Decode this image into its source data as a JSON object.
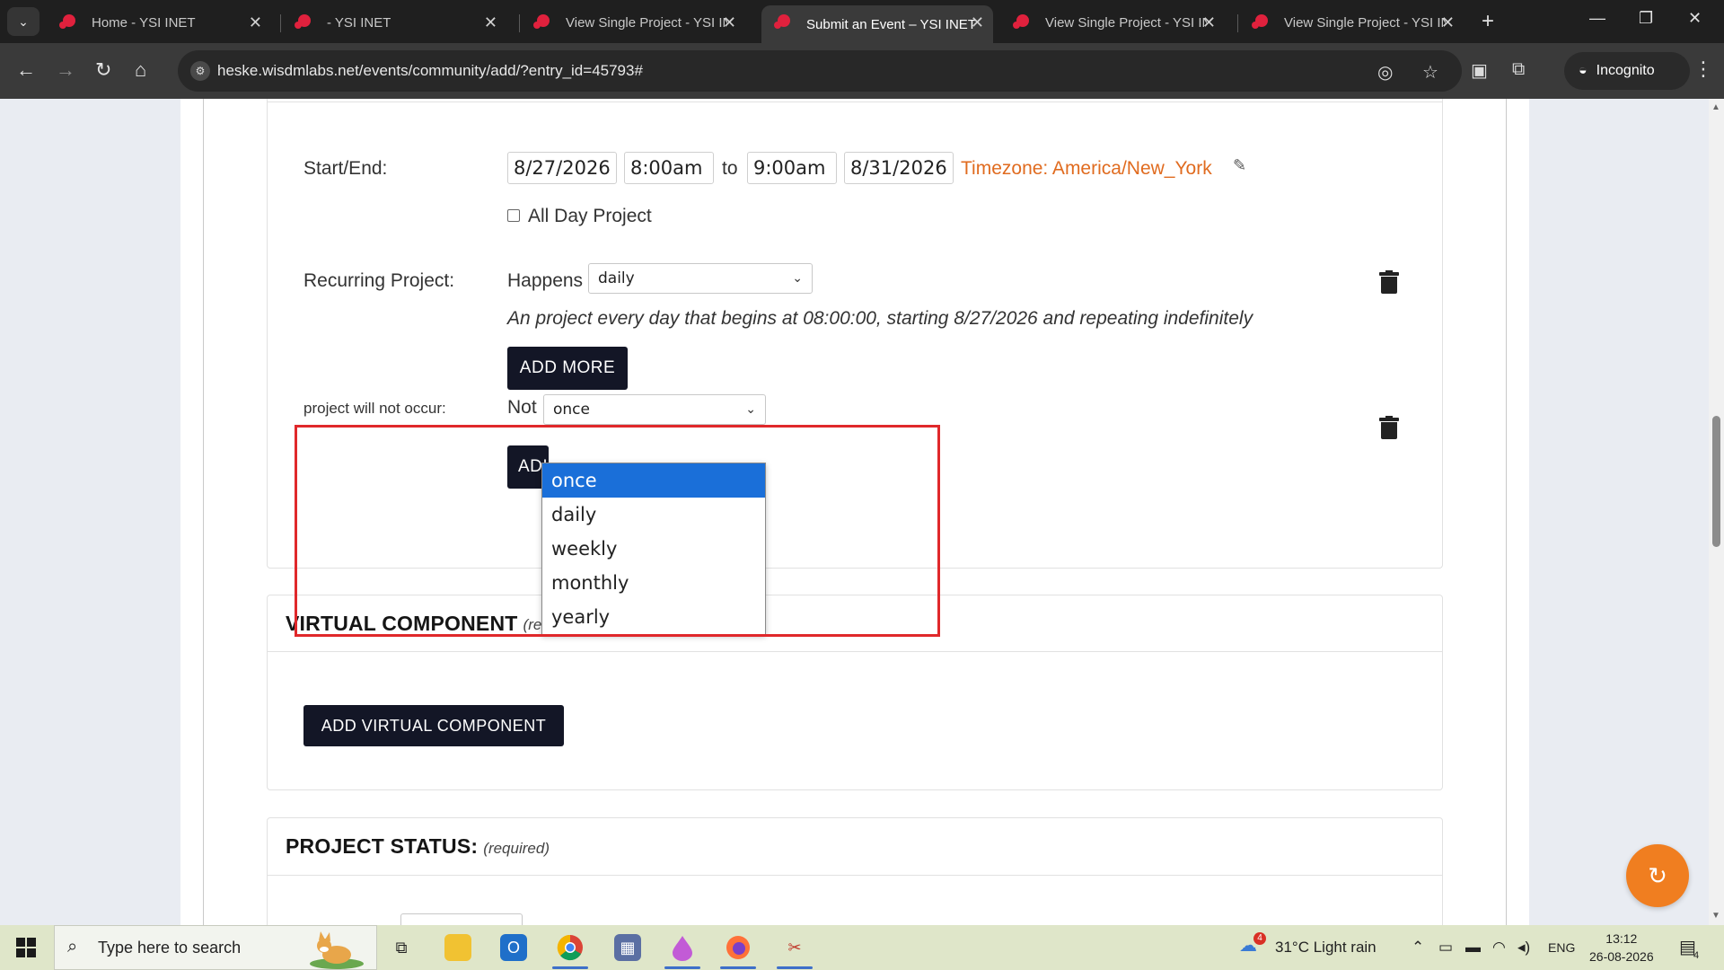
{
  "browser": {
    "tabs": [
      {
        "title": "Home - YSI INET",
        "active": false
      },
      {
        "title": "- YSI INET",
        "active": false
      },
      {
        "title": "View Single Project - YSI IN",
        "active": false
      },
      {
        "title": "Submit an Event – YSI INET",
        "active": true
      },
      {
        "title": "View Single Project - YSI IN",
        "active": false
      },
      {
        "title": "View Single Project - YSI IN",
        "active": false
      }
    ],
    "url": "heske.wisdmlabs.net/events/community/add/?entry_id=45793#",
    "incognito_label": "Incognito"
  },
  "form": {
    "start_end_label": "Start/End:",
    "start_date": "8/27/2026",
    "start_time": "8:00am",
    "to_label": "to",
    "end_time": "9:00am",
    "end_date": "8/31/2026",
    "timezone": "Timezone: America/New_York",
    "all_day_label": "All Day Project",
    "recurring_label": "Recurring Project:",
    "happens_label": "Happens",
    "happens_value": "daily",
    "recurring_description": "An project every day that begins at 08:00:00, starting 8/27/2026 and repeating indefinitely",
    "add_more_label": "ADD MORE",
    "exclusion_label": "project will not occur:",
    "not_label": "Not",
    "not_value": "once",
    "add_more_partial": "ADI",
    "dropdown_options": [
      "once",
      "daily",
      "weekly",
      "monthly",
      "yearly"
    ]
  },
  "virtual_component": {
    "heading": "VIRTUAL COMPONENT",
    "required_partial": "(req",
    "button_label": "ADD VIRTUAL COMPONENT"
  },
  "project_status": {
    "heading": "PROJECT STATUS:",
    "required": "(required)"
  },
  "taskbar": {
    "search_placeholder": "Type here to search",
    "weather_badge": "4",
    "weather": "31°C  Light rain",
    "lang": "ENG",
    "time": "13:12",
    "date": "26-08-2026",
    "notification_count": "4"
  },
  "colors": {
    "accent_orange": "#e06b1f",
    "dark_button": "#131626",
    "highlight_red": "#e0282b",
    "selected_option": "#1a6fd9"
  }
}
